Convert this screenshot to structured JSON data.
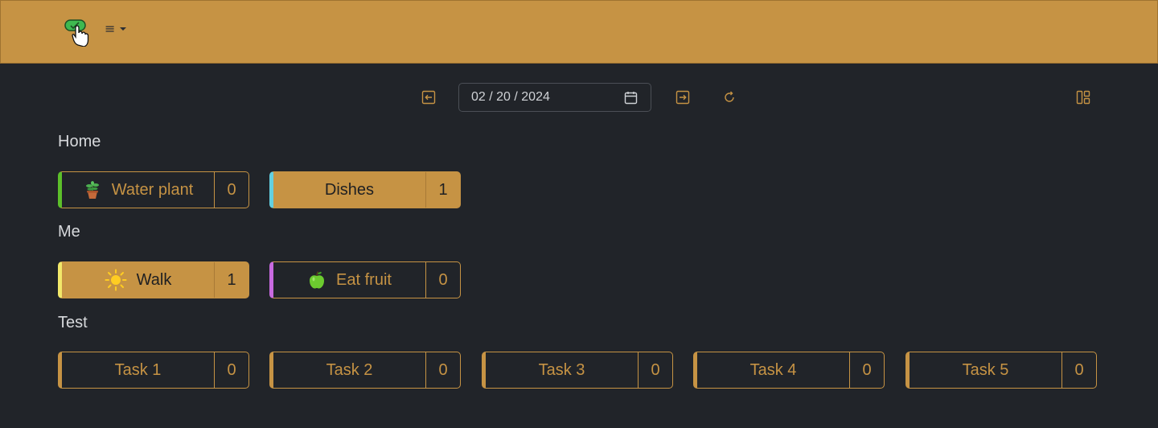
{
  "navbar": {
    "menu_icon": "≡"
  },
  "toolbar": {
    "date_value": "02 / 20 / 2024",
    "icons": [
      "prev-day-icon",
      "calendar-icon",
      "next-day-icon",
      "refresh-icon",
      "layout-icon"
    ]
  },
  "colors": {
    "accent": "#c69344",
    "background": "#212429"
  },
  "sections": [
    {
      "title": "Home",
      "tasks": [
        {
          "label": "Water plant",
          "count": "0",
          "emoji": "potted-plant",
          "stripe": "#5cbf2a",
          "done": false
        },
        {
          "label": "Dishes",
          "count": "1",
          "emoji": "",
          "stripe": "#63cfe0",
          "done": true
        }
      ]
    },
    {
      "title": "Me",
      "tasks": [
        {
          "label": "Walk",
          "count": "1",
          "emoji": "sun",
          "stripe": "#f2e86a",
          "done": true
        },
        {
          "label": "Eat fruit",
          "count": "0",
          "emoji": "green-apple",
          "stripe": "#c86ae0",
          "done": false
        }
      ]
    },
    {
      "title": "Test",
      "tasks": [
        {
          "label": "Task 1",
          "count": "0",
          "done": false
        },
        {
          "label": "Task 2",
          "count": "0",
          "done": false
        },
        {
          "label": "Task 3",
          "count": "0",
          "done": false
        },
        {
          "label": "Task 4",
          "count": "0",
          "done": false
        },
        {
          "label": "Task 5",
          "count": "0",
          "done": false
        }
      ]
    }
  ]
}
